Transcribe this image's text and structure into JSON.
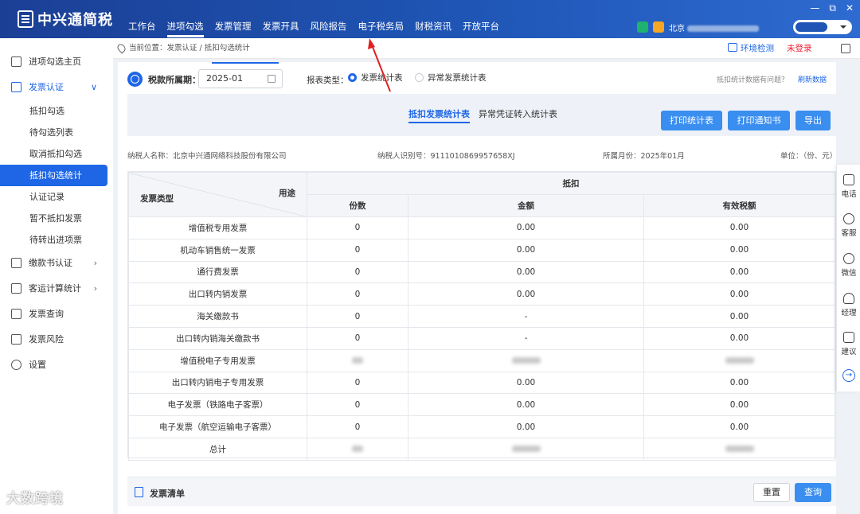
{
  "app": {
    "logo_text": "中兴通简税"
  },
  "topnav": [
    "工作台",
    "进项勾选",
    "发票管理",
    "发票开具",
    "风险报告",
    "电子税务局",
    "财税资讯",
    "开放平台"
  ],
  "topright": {
    "company_prefix": "北京"
  },
  "window_controls": {
    "minimize": "—",
    "maximize": "⧉",
    "close": "✕"
  },
  "sidebar": {
    "items": [
      {
        "label": "进项勾选主页",
        "icon": "home-icon"
      },
      {
        "label": "发票认证",
        "icon": "certify-icon",
        "arrow": "∨"
      },
      {
        "label": "缴款书认证",
        "icon": "tax-payment-icon",
        "arrow": "›"
      },
      {
        "label": "客运计算统计",
        "icon": "passenger-icon",
        "arrow": "›"
      },
      {
        "label": "发票查询",
        "icon": "query-icon"
      },
      {
        "label": "发票风险",
        "icon": "risk-icon"
      },
      {
        "label": "设置",
        "icon": "gear-icon"
      }
    ],
    "sub_items": [
      "抵扣勾选",
      "待勾选列表",
      "取消抵扣勾选",
      "抵扣勾选统计",
      "认证记录",
      "暂不抵扣发票",
      "待转出进项票"
    ]
  },
  "breadcrumb": {
    "text": "当前位置：发票认证 / 抵扣勾选统计",
    "env_check": "环境检测",
    "not_logged_in": "未登录"
  },
  "filter": {
    "period_label": "税款所属期：",
    "period_value": "2025-01",
    "report_type_label": "报表类型：",
    "report_options": [
      "发票统计表",
      "异常发票统计表"
    ],
    "selected_report": "发票统计表",
    "help_text": "抵扣统计数据有问题？",
    "refresh_text": "刷新数据"
  },
  "subtabs": [
    "抵扣发票统计表",
    "异常凭证转入统计表"
  ],
  "buttons": {
    "print_stats": "打印统计表",
    "print_notice": "打印通知书",
    "export": "导出",
    "reset": "重置",
    "query": "查询"
  },
  "meta": {
    "taxpayer_name": "纳税人名称：北京中兴通网络科技股份有限公司",
    "taxpayer_id": "纳税人识别号：911101086995​7658XJ",
    "month": "所属月份：2025年01月",
    "unit": "单位：（份、元）"
  },
  "table": {
    "diag_top": "用途",
    "diag_bottom": "发票类型",
    "group_header": "抵扣",
    "columns": [
      "份数",
      "金额",
      "有效税额"
    ],
    "rows": [
      {
        "type": "增值税专用发票",
        "count": "0",
        "amount": "0.00",
        "tax": "0.00"
      },
      {
        "type": "机动车销售统一发票",
        "count": "0",
        "amount": "0.00",
        "tax": "0.00"
      },
      {
        "type": "通行费发票",
        "count": "0",
        "amount": "0.00",
        "tax": "0.00"
      },
      {
        "type": "出口转内销发票",
        "count": "0",
        "amount": "0.00",
        "tax": "0.00"
      },
      {
        "type": "海关缴款书",
        "count": "0",
        "amount": "-",
        "tax": "0.00"
      },
      {
        "type": "出口转内销海关缴款书",
        "count": "0",
        "amount": "-",
        "tax": "0.00"
      },
      {
        "type": "增值税电子专用发票",
        "count": "",
        "amount": "",
        "tax": "",
        "blurred": true
      },
      {
        "type": "出口转内销电子专用发票",
        "count": "0",
        "amount": "0.00",
        "tax": "0.00"
      },
      {
        "type": "电子发票（铁路电子客票）",
        "count": "0",
        "amount": "0.00",
        "tax": "0.00"
      },
      {
        "type": "电子发票（航空运输电子客票）",
        "count": "0",
        "amount": "0.00",
        "tax": "0.00"
      },
      {
        "type": "总计",
        "count": "",
        "amount": "",
        "tax": "",
        "blurred": true
      }
    ]
  },
  "invoice_list": {
    "title": "发票清单"
  },
  "rightbar": [
    {
      "label": "电话",
      "icon": "phone-icon"
    },
    {
      "label": "客服",
      "icon": "headset-icon"
    },
    {
      "label": "微信",
      "icon": "wechat-icon"
    },
    {
      "label": "经理",
      "icon": "manager-icon"
    },
    {
      "label": "建议",
      "icon": "edit-icon"
    }
  ],
  "watermark": "大数跨境",
  "colors": {
    "primary": "#1e66e6",
    "header": "#1f56b6",
    "danger": "#e23333"
  }
}
